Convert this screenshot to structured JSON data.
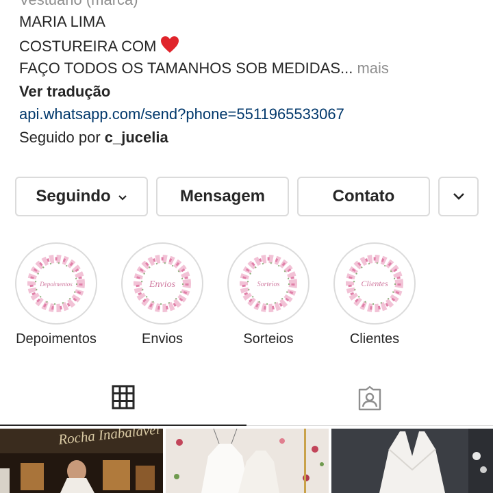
{
  "profile": {
    "category": "Vestuário (marca)",
    "name": "MARIA LIMA",
    "bio_line_2": "COSTUREIRA COM",
    "bio_line_3": "FAÇO TODOS OS TAMANHOS SOB MEDIDAS",
    "ellipsis": "...",
    "more": "mais",
    "translate": "Ver tradução",
    "link": "api.whatsapp.com/send?phone=5511965533067",
    "followed_by_prefix": "Seguido por",
    "followed_by_user": "c_jucelia"
  },
  "actions": {
    "following": "Seguindo",
    "message": "Mensagem",
    "contact": "Contato"
  },
  "highlights": [
    {
      "label": "Depoimentos",
      "cover_text": "Depoimentos"
    },
    {
      "label": "Envios",
      "cover_text": "Envios"
    },
    {
      "label": "Sorteios",
      "cover_text": "Sorteios"
    },
    {
      "label": "Clientes",
      "cover_text": "Clientes"
    }
  ],
  "tabs": {
    "active": "grid",
    "icons": [
      "grid-icon",
      "tagged-icon"
    ]
  },
  "posts": [
    {
      "caption": "Rocha Inabalável"
    },
    {
      "caption": ""
    },
    {
      "caption": ""
    }
  ],
  "colors": {
    "link": "#00376b",
    "heart": "#e0242b",
    "border": "#dbdbdb",
    "muted": "#8e8e8e",
    "highlight_pink": "#e8a0c0"
  }
}
